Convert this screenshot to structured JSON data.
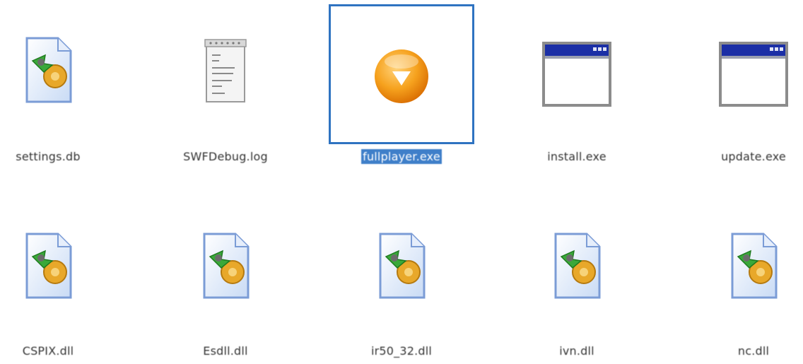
{
  "files": [
    {
      "name": "settings.db",
      "icon": "dll-gear-file-icon",
      "selected": false
    },
    {
      "name": "SWFDebug.log",
      "icon": "notepad-text-file-icon",
      "selected": false
    },
    {
      "name": "fullplayer.exe",
      "icon": "orange-player-app-icon",
      "selected": true
    },
    {
      "name": "install.exe",
      "icon": "generic-window-app-icon",
      "selected": false
    },
    {
      "name": "update.exe",
      "icon": "generic-window-app-icon",
      "selected": false
    },
    {
      "name": "CSPIX.dll",
      "icon": "dll-gear-file-icon",
      "selected": false
    },
    {
      "name": "Esdll.dll",
      "icon": "dll-gear-file-icon",
      "selected": false
    },
    {
      "name": "ir50_32.dll",
      "icon": "dll-gear-file-icon",
      "selected": false
    },
    {
      "name": "ivn.dll",
      "icon": "dll-gear-file-icon",
      "selected": false
    },
    {
      "name": "nc.dll",
      "icon": "dll-gear-file-icon",
      "selected": false
    }
  ],
  "colors": {
    "selection_border": "#2f73c1",
    "selection_label_bg": "#3f7fc9",
    "label_text": "#333333"
  }
}
